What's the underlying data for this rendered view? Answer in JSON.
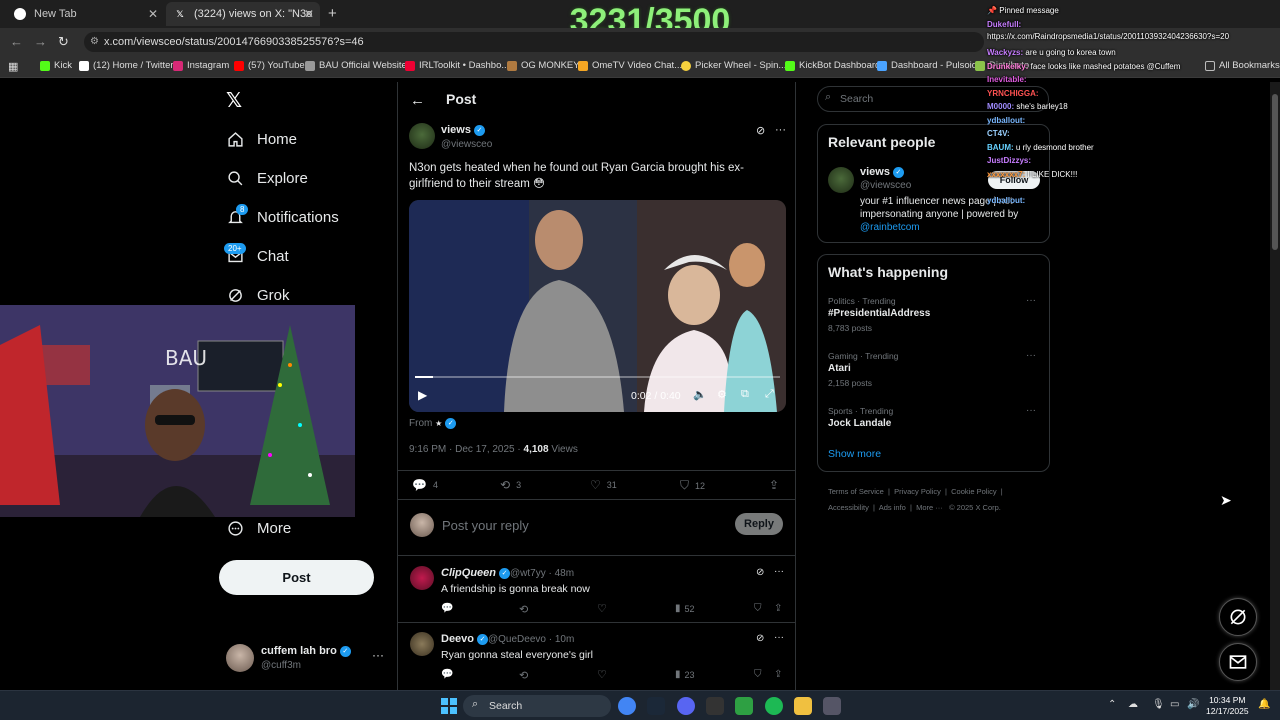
{
  "stream_counter": "3231/3500",
  "tabs": [
    {
      "title": "New Tab"
    },
    {
      "title": "(3224) views on X: \"N3on gets h"
    }
  ],
  "address": {
    "url": "x.com/viewsceo/status/2001476690338525576?s=46"
  },
  "bookmarks": [
    "Kick",
    "(12) Home / Twitter",
    "Instagram",
    "(57) YouTube",
    "BAU Official Website",
    "IRLToolkit • Dashbo...",
    "OG MONKEY",
    "OmeTV Video Chat...",
    "Picker Wheel - Spin...",
    "KickBot Dashboard",
    "Dashboard - Pulsoid",
    "Distributo",
    "All Bookmarks"
  ],
  "nav": {
    "items": [
      {
        "label": "Home"
      },
      {
        "label": "Explore"
      },
      {
        "label": "Notifications",
        "badge": "8"
      },
      {
        "label": "Chat",
        "badge": "20+"
      },
      {
        "label": "Grok"
      },
      {
        "label": "More"
      }
    ],
    "post_button": "Post"
  },
  "account": {
    "name": "cuffem lah bro",
    "handle": "@cuff3m"
  },
  "post": {
    "header_title": "Post",
    "author_name": "views",
    "author_handle": "@viewsceo",
    "text": "N3on gets heated when he found out Ryan Garcia brought his ex-girlfriend to their stream 😳",
    "video_time": "0:02 / 0:40",
    "video_progress": 0.05,
    "from_label": "From",
    "timestamp": "9:16 PM · Dec 17, 2025 ·",
    "views_count": "4,108",
    "views_label": "Views",
    "replies": "4",
    "reposts": "3",
    "likes": "31",
    "bookmarks": "12"
  },
  "reply_box": {
    "placeholder": "Post your reply",
    "button": "Reply"
  },
  "replies": [
    {
      "name": "ClipQueen",
      "handle": "@wt7yy",
      "time": "· 48m",
      "text": "A friendship is gonna break now",
      "views": "52"
    },
    {
      "name": "Deevo",
      "handle": "@QueDeevo",
      "time": "· 10m",
      "text": "Ryan gonna steal everyone's girl",
      "views": "23"
    }
  ],
  "search": {
    "placeholder": "Search"
  },
  "relevant": {
    "title": "Relevant people",
    "name": "views",
    "handle": "@viewsceo",
    "bio": "your #1 influencer news page | not impersonating anyone | powered by",
    "link": "@rainbetcom",
    "follow": "Follow"
  },
  "happening": {
    "title": "What's happening",
    "trends": [
      {
        "category": "Politics · Trending",
        "name": "#PresidentialAddress",
        "count": "8,783 posts"
      },
      {
        "category": "Gaming · Trending",
        "name": "Atari",
        "count": "2,158 posts"
      },
      {
        "category": "Sports · Trending",
        "name": "Jock Landale",
        "count": ""
      }
    ],
    "show_more": "Show more"
  },
  "footer": {
    "line1": [
      "Terms of Service",
      "Privacy Policy",
      "Cookie Policy"
    ],
    "line2": [
      "Accessibility",
      "Ads info",
      "More ···",
      "© 2025 X Corp."
    ]
  },
  "chat": {
    "pinned_label": "Pinned message",
    "pinned_user": "Dukefull:",
    "pinned_text": "https://x.com/Raindropsmedia1/status/2001103932404236630?s=20",
    "messages": [
      {
        "user": "Wackyzs:",
        "text": "are u going to korea town",
        "color": "#c77dff"
      },
      {
        "user": "Drunkelky:",
        "text": "face looks like mashed potatoes @Cuffem",
        "color": "#ff7ad9"
      },
      {
        "user": "Inevitable:",
        "text": "",
        "color": "#e05ce0"
      },
      {
        "user": "YRNCHIGGA:",
        "text": "",
        "color": "#ff5252"
      },
      {
        "user": "M0000:",
        "text": "she's barley18",
        "color": "#a18cff"
      },
      {
        "user": "ydballout:",
        "text": "",
        "color": "#7ab8ff"
      },
      {
        "user": "CT4V:",
        "text": "",
        "color": "#9ad0ff"
      },
      {
        "user": "BAUM:",
        "text": "u rly desmond brother",
        "color": "#66d1ff"
      },
      {
        "user": "JustDizzys:",
        "text": "",
        "color": "#c77dff"
      },
      {
        "user": "xxxxxxx7:",
        "text": "I LIKE DICK!!!",
        "color": "#ff9a3d"
      },
      {
        "user": "ydballout:",
        "text": "",
        "color": "#7ab8ff"
      }
    ]
  },
  "taskbar": {
    "search": "Search",
    "time": "10:34 PM",
    "date": "12/17/2025"
  },
  "colors": {
    "accent": "#1d9bf0",
    "counter": "#8ef07a",
    "bg": "#000000"
  }
}
